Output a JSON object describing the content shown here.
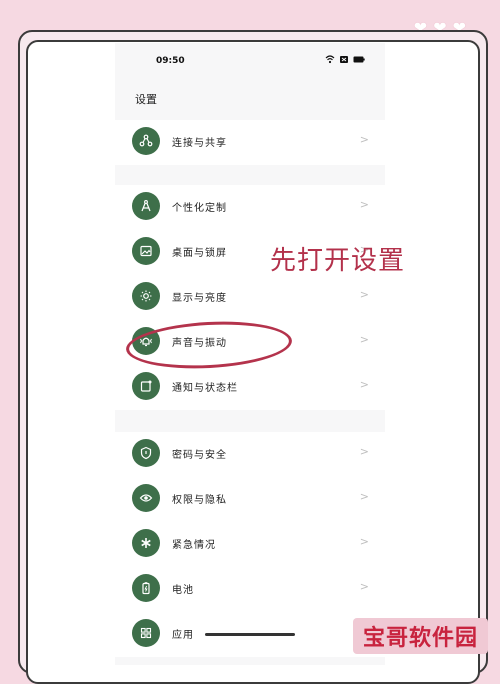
{
  "status_bar": {
    "time": "09:50"
  },
  "page": {
    "title": "设置"
  },
  "annotation": {
    "text": "先打开设置"
  },
  "groups": [
    {
      "items": [
        {
          "label": "连接与共享",
          "icon": "link-share-icon"
        }
      ]
    },
    {
      "items": [
        {
          "label": "个性化定制",
          "icon": "compass-icon"
        },
        {
          "label": "桌面与锁屏",
          "icon": "picture-icon"
        },
        {
          "label": "显示与亮度",
          "icon": "sun-icon"
        },
        {
          "label": "声音与振动",
          "icon": "bell-vibrate-icon"
        },
        {
          "label": "通知与状态栏",
          "icon": "notification-icon"
        }
      ]
    },
    {
      "items": [
        {
          "label": "密码与安全",
          "icon": "shield-icon"
        },
        {
          "label": "权限与隐私",
          "icon": "eye-icon"
        },
        {
          "label": "紧急情况",
          "icon": "emergency-icon"
        },
        {
          "label": "电池",
          "icon": "battery-icon"
        },
        {
          "label": "应用",
          "icon": "apps-grid-icon"
        }
      ]
    }
  ],
  "watermark": {
    "text": "宝哥软件园"
  },
  "colors": {
    "icon_bg": "#3e6f4a",
    "annotation": "#b3314b",
    "background": "#f6d9e2"
  }
}
